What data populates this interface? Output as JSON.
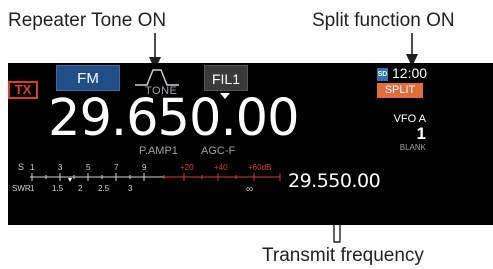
{
  "callouts": {
    "repeater_tone": "Repeater Tone ON",
    "split_function": "Split function ON",
    "transmit_frequency": "Transmit frequency"
  },
  "screen": {
    "tx_indicator": "TX",
    "mode_button": "FM",
    "tone_indicator": "TONE",
    "filter_button": "FIL1",
    "storage_icon": "SD",
    "clock": "12:00",
    "split_badge": "SPLIT",
    "main_frequency": "29.650.00",
    "vfo_label": "VFO A",
    "memory_channel": "1",
    "memory_name": "BLANK",
    "preamp": "P.AMP1",
    "agc": "AGC-F",
    "sub_frequency": "29.550.00",
    "meter": {
      "s_label": "S",
      "swr_label": "SWR",
      "s_scale": [
        "1",
        "3",
        "5",
        "7",
        "9"
      ],
      "s_plus_scale": [
        "+20",
        "+40",
        "+60dB"
      ],
      "swr_scale": [
        "1",
        "1.5",
        "2",
        "2.5",
        "3",
        "∞"
      ]
    },
    "colors": {
      "background": "#000000",
      "mode_button": "#1f4f86",
      "tx_red": "#e03a2a",
      "split_orange": "#e46b3b",
      "meter_red": "#e03a2a",
      "label_gray": "#9aa0a6"
    }
  }
}
